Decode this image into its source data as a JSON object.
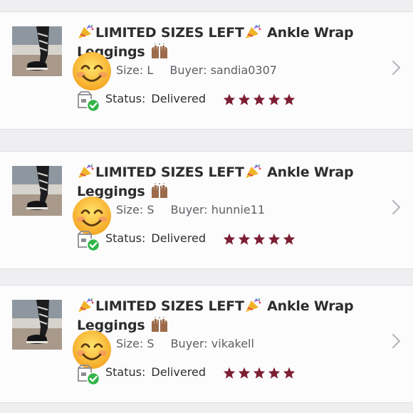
{
  "orders": [
    {
      "title_line1": "LIMITED SIZES LEFT",
      "title_tail": " Ankle Wrap",
      "title_line2": "Leggings",
      "size_label": "Size:",
      "size_value": "L",
      "buyer_label": "Buyer:",
      "buyer_value": "sandia0307",
      "status_label": "Status:",
      "status_value": "Delivered",
      "rating": 5
    },
    {
      "title_line1": "LIMITED SIZES LEFT",
      "title_tail": " Ankle Wrap",
      "title_line2": "Leggings",
      "size_label": "Size:",
      "size_value": "S",
      "buyer_label": "Buyer:",
      "buyer_value": "hunnie11",
      "status_label": "Status:",
      "status_value": "Delivered",
      "rating": 5
    },
    {
      "title_line1": "LIMITED SIZES LEFT",
      "title_tail": " Ankle Wrap",
      "title_line2": "Leggings",
      "size_label": "Size:",
      "size_value": "S",
      "buyer_label": "Buyer:",
      "buyer_value": "vikakell",
      "status_label": "Status:",
      "status_value": "Delivered",
      "rating": 5
    }
  ],
  "icons": {
    "party": "party-popper-icon",
    "hands": "raised-hands-icon",
    "smiley": "smiling-face-icon",
    "box": "delivered-box-icon",
    "star": "star-icon",
    "chevron": "chevron-right-icon"
  },
  "colors": {
    "star": "#7d1f33",
    "check": "#33b54a",
    "background": "#efeff1",
    "card": "#fcfcfd"
  }
}
